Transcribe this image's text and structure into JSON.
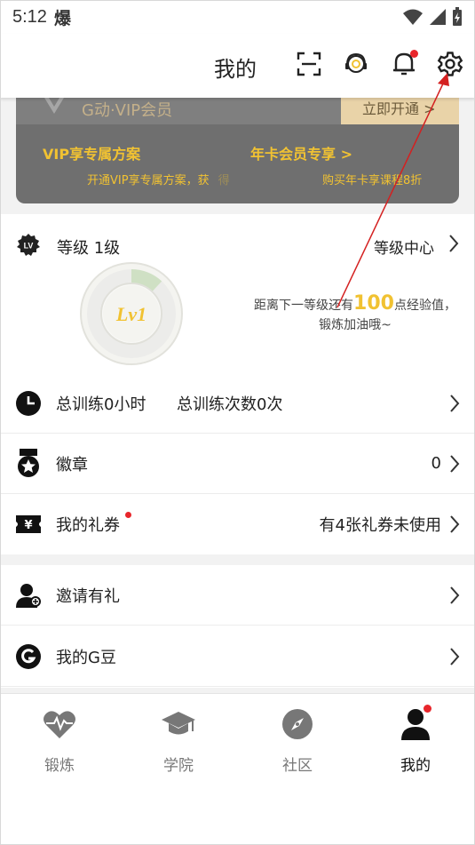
{
  "status_bar": {
    "time": "5:12",
    "carrier_glyph": "爆"
  },
  "header": {
    "title": "我的"
  },
  "vip": {
    "title": "G动·VIP会员",
    "open_button": "立即开通 >",
    "plan_left": "VIP享专属方案",
    "plan_left_sub": "开通VIP享专属方案，获",
    "plan_left_sub_faded": "得",
    "plan_right": "年卡会员专享 >",
    "plan_right_sub": "购买年卡享课程8折"
  },
  "level": {
    "label": "等级 1级",
    "center_link": "等级中心",
    "badge_text": "Lv1",
    "progress": 0.12,
    "hint_before": "距离下一等级还有",
    "hint_number": "100",
    "hint_after": "点经验值，锻炼加油哦~"
  },
  "training": {
    "hours": "总训练0小时",
    "count": "总训练次数0次"
  },
  "badges": {
    "label": "徽章",
    "value": "0"
  },
  "coupons": {
    "label": "我的礼券",
    "value": "有4张礼券未使用",
    "icon_glyph": "¥"
  },
  "invite": {
    "label": "邀请有礼"
  },
  "gbean": {
    "label": "我的G豆"
  },
  "nav": [
    {
      "label": "锻炼",
      "icon": "heart-pulse-icon"
    },
    {
      "label": "学院",
      "icon": "graduation-cap-icon"
    },
    {
      "label": "社区",
      "icon": "compass-icon"
    },
    {
      "label": "我的",
      "icon": "user-icon"
    }
  ],
  "colors": {
    "accent_gold": "#f1c232",
    "notify_red": "#e8262b",
    "annotation_red": "#d42020"
  }
}
